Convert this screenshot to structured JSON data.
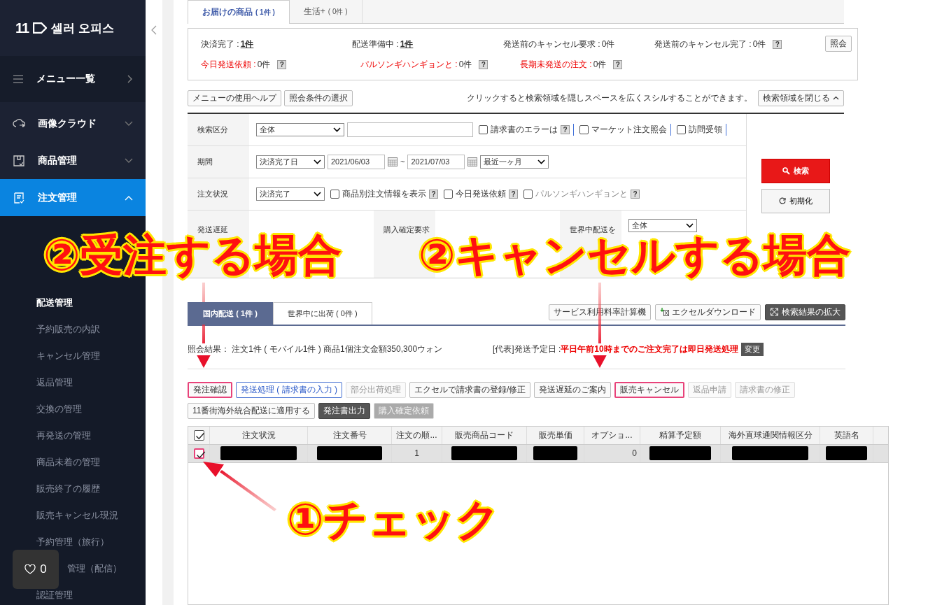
{
  "sidebar": {
    "logo": {
      "mark": "11",
      "name": "셀러 오피스"
    },
    "menu_all": {
      "label": "メニュー一覧"
    },
    "groups": [
      {
        "label": "画像クラウド",
        "expanded": false,
        "selected": false
      },
      {
        "label": "商品管理",
        "expanded": false,
        "selected": false
      },
      {
        "label": "注文管理",
        "expanded": true,
        "selected": true
      }
    ],
    "items": [
      {
        "label": "配送管理",
        "selected": true
      },
      {
        "label": "予約販売の内訳",
        "selected": false
      },
      {
        "label": "キャンセル管理",
        "selected": false
      },
      {
        "label": "返品管理",
        "selected": false
      },
      {
        "label": "交換の管理",
        "selected": false
      },
      {
        "label": "再発送の管理",
        "selected": false
      },
      {
        "label": "商品未着の管理",
        "selected": false
      },
      {
        "label": "販売終了の履歴",
        "selected": false
      },
      {
        "label": "販売キャンセル現況",
        "selected": false
      },
      {
        "label": "予約管理（旅行）",
        "selected": false
      },
      {
        "label": "管理（配信）",
        "selected": false
      },
      {
        "label": "認証管理",
        "selected": false
      }
    ],
    "like_count": "0"
  },
  "top_tabs": [
    {
      "label": "お届けの商品",
      "count": "( 1件 )",
      "selected": true
    },
    {
      "label": "生活+",
      "count": "( 0件 )",
      "selected": false
    }
  ],
  "status_summary": {
    "rows": [
      [
        {
          "label": "決済完了 : ",
          "value": "1件",
          "link": true,
          "alert": false
        },
        {
          "label": "配送準備中 : ",
          "value": "1件",
          "link": true,
          "alert": false
        },
        {
          "label": "発送前のキャンセル要求 : ",
          "value": "0件",
          "link": false,
          "alert": false
        },
        {
          "label": "発送前のキャンセル完了 : ",
          "value": "0件",
          "link": false,
          "alert": false,
          "help": "?"
        }
      ],
      [
        {
          "label": "今日発送依頼 : ",
          "value": "0件",
          "link": false,
          "alert": true,
          "help": "?"
        },
        {
          "label": "パルソンギハンギョンと : ",
          "value": "0件",
          "link": false,
          "alert": true,
          "help": "?"
        },
        {
          "label": "長期未発送の注文 : ",
          "value": "0件",
          "link": false,
          "alert": true,
          "help": "?"
        }
      ]
    ],
    "button": "照会"
  },
  "toolbar": {
    "buttons": [
      "メニューの使用ヘルプ",
      "照会条件の選択"
    ],
    "hint": "クリックすると検索領域を隠しスペースを広くスシルすることができます。",
    "toggle": "検索領域を閉じる"
  },
  "search_form": {
    "rows": [
      {
        "label": "検索区分",
        "fields": [
          {
            "kind": "select",
            "value": "全体"
          },
          {
            "kind": "text"
          },
          {
            "kind": "checkbox",
            "label": "請求書のエラーは",
            "checked": false,
            "help": "?"
          },
          {
            "kind": "checkbox",
            "label": "マーケット注文照会",
            "checked": false
          },
          {
            "kind": "checkbox",
            "label": "訪問受領",
            "checked": false
          }
        ]
      },
      {
        "label": "期間",
        "fields": [
          {
            "kind": "select",
            "value": "決済完了日"
          },
          {
            "kind": "date",
            "value": "2021/06/03"
          },
          {
            "kind": "calendar"
          },
          {
            "kind": "sep",
            "value": "~"
          },
          {
            "kind": "date",
            "value": "2021/07/03"
          },
          {
            "kind": "calendar"
          },
          {
            "kind": "select",
            "value": "最近一ヶ月"
          }
        ]
      },
      {
        "label": "注文状況",
        "fields": [
          {
            "kind": "select",
            "value": "決済完了"
          },
          {
            "kind": "checkbox",
            "label": "商品別注文情報を表示",
            "checked": false,
            "help": "?"
          },
          {
            "kind": "checkbox",
            "label": "今日発送依頼",
            "checked": false,
            "help": "?"
          },
          {
            "kind": "checkbox",
            "label": "パルソンギハンギョンと",
            "checked": false,
            "help": "?",
            "disabled": true
          }
        ]
      }
    ],
    "split_row": [
      {
        "label": "発送遅延"
      },
      {
        "label": "購入確定要求"
      },
      {
        "label": "世界中配送を",
        "select": "全体"
      }
    ],
    "search_button": "検索",
    "reset_button": "初期化"
  },
  "result_tabs": [
    {
      "label": "国内配送 ( 1件 )",
      "selected": true
    },
    {
      "label": "世界中に出荷 ( 0件 )",
      "selected": false
    }
  ],
  "result_tools": [
    {
      "label": "サービス利用料率計算機",
      "kind": "plain"
    },
    {
      "label": "エクセルダウンロード",
      "kind": "excel"
    },
    {
      "label": "検索結果の拡大",
      "kind": "expand"
    }
  ],
  "result_info": {
    "summary": "照会結果： 注文1件 ( モバイル1件 ) 商品1個注文金額350,300ウォン",
    "ship_label": "[代表]発送予定日 : ",
    "ship_note": "平日午前10時までのご注文完了は即日発送処理",
    "change": "変更"
  },
  "actions": [
    [
      {
        "label": "発注確認",
        "kind": "normal",
        "disabled": false,
        "highlighted": true
      },
      {
        "label": "発送処理 ( 請求書の入力 )",
        "kind": "primary",
        "disabled": false,
        "highlighted": false
      },
      {
        "label": "部分出荷処理",
        "kind": "normal",
        "disabled": true,
        "highlighted": false
      },
      {
        "label": "エクセルで請求書の登録/修正",
        "kind": "normal",
        "disabled": false,
        "highlighted": false
      },
      {
        "label": "発送遅延のご案内",
        "kind": "normal",
        "disabled": false,
        "highlighted": false
      },
      {
        "label": "販売キャンセル",
        "kind": "normal",
        "disabled": false,
        "highlighted": true
      },
      {
        "label": "返品申請",
        "kind": "normal",
        "disabled": true,
        "highlighted": false
      },
      {
        "label": "請求書の修正",
        "kind": "normal",
        "disabled": true,
        "highlighted": false
      }
    ],
    [
      {
        "label": "11番街海外統合配送に適用する",
        "kind": "normal",
        "disabled": false,
        "highlighted": false
      },
      {
        "label": "発注書出力",
        "kind": "dark",
        "disabled": false,
        "highlighted": false
      },
      {
        "label": "購入確定依頼",
        "kind": "dark",
        "disabled": true,
        "highlighted": false
      }
    ]
  ],
  "table": {
    "columns": [
      {
        "kind": "checkbox",
        "checked": true
      },
      {
        "label": "注文状況"
      },
      {
        "label": "注文番号"
      },
      {
        "label": "注文の順..."
      },
      {
        "label": "販売商品コード"
      },
      {
        "label": "販売単価"
      },
      {
        "label": "オプショ..."
      },
      {
        "label": "精算予定額"
      },
      {
        "label": "海外直球通関情報区分"
      },
      {
        "label": "英語名"
      }
    ],
    "rows": [
      {
        "selected": true,
        "cells": [
          {
            "kind": "checkbox",
            "checked": true,
            "highlighted": true
          },
          {
            "kind": "redacted"
          },
          {
            "kind": "redacted"
          },
          {
            "kind": "text",
            "text": "1"
          },
          {
            "kind": "redacted"
          },
          {
            "kind": "redacted"
          },
          {
            "kind": "number",
            "text": "0"
          },
          {
            "kind": "redacted"
          },
          {
            "kind": "redacted"
          },
          {
            "kind": "redacted"
          }
        ]
      }
    ]
  },
  "annotations": [
    {
      "text": "②受注する場合",
      "kind": "large"
    },
    {
      "text": "②キャンセルする場合",
      "kind": "large"
    },
    {
      "text": "①チェック",
      "kind": "large"
    }
  ]
}
